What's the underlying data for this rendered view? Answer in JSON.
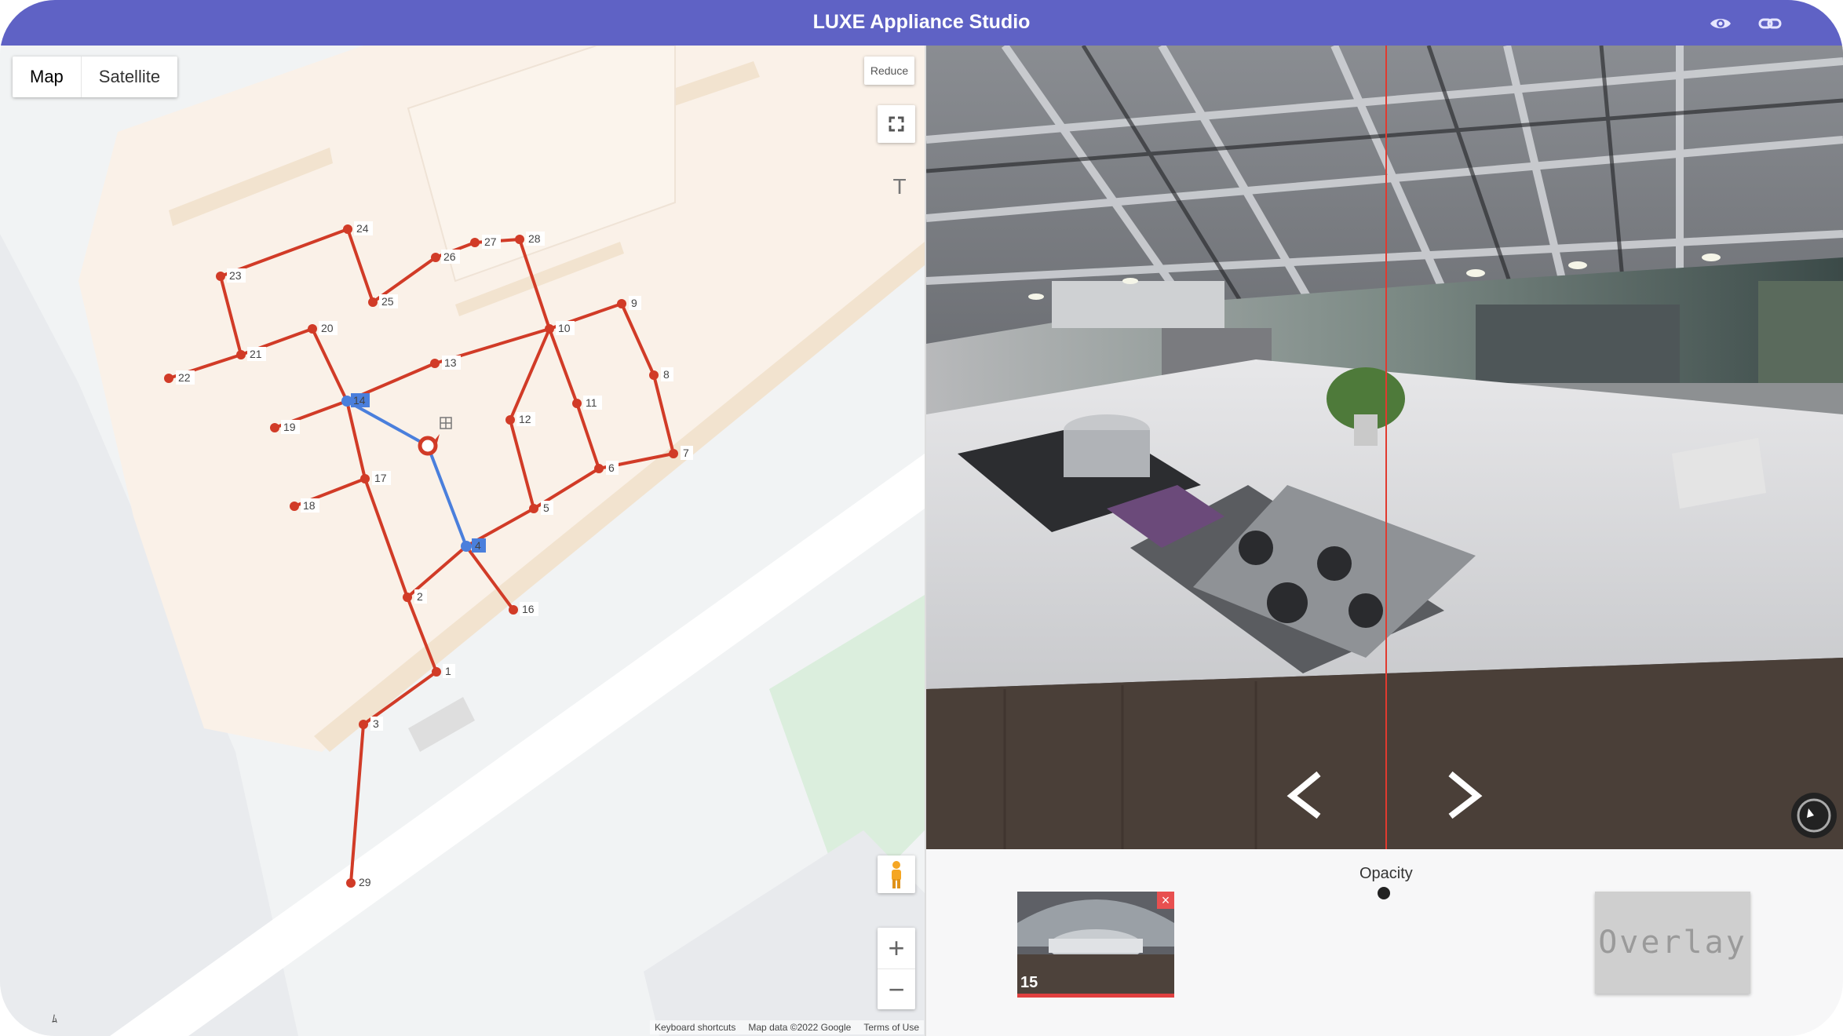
{
  "app": {
    "title": "LUXE Appliance Studio",
    "brand_color": "#5f62c5"
  },
  "header_icons": [
    "eye-icon",
    "link-icon"
  ],
  "map": {
    "type_tabs": [
      {
        "label": "Map",
        "active": true
      },
      {
        "label": "Satellite",
        "active": false
      }
    ],
    "reduce_label": "Reduce",
    "text_tool_label": "T",
    "zoom_in_label": "+",
    "zoom_out_label": "−",
    "footer": {
      "shortcuts": "Keyboard shortcuts",
      "map_data": "Map data ©2022 Google",
      "terms": "Terms of Use"
    },
    "path_color": "#d13b27",
    "active_path_color": "#4a7fdc",
    "node_labels": [
      "1",
      "2",
      "3",
      "4",
      "5",
      "6",
      "7",
      "8",
      "9",
      "10",
      "11",
      "12",
      "13",
      "14",
      "16",
      "17",
      "18",
      "19",
      "20",
      "21",
      "22",
      "23",
      "24",
      "25",
      "26",
      "27",
      "28",
      "29"
    ]
  },
  "viewer": {
    "opacity_label": "Opacity",
    "thumbnail_number": "15",
    "thumbnail_close": "×",
    "overlay_label": "Overlay",
    "split_line_color": "#e13a2f"
  }
}
